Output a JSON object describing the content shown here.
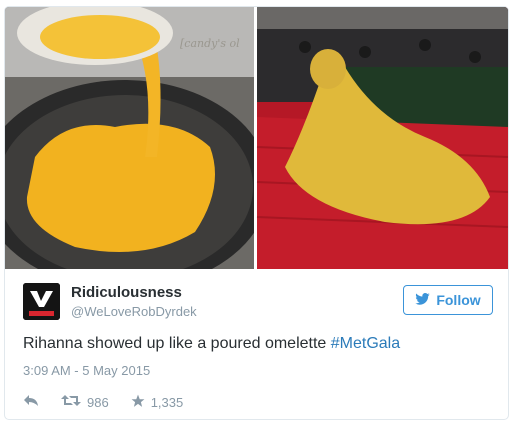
{
  "tweet": {
    "image_watermark": "[candy's ol",
    "author_name": "Ridiculousness",
    "author_handle": "@WeLoveRobDyrdek",
    "follow_label": "Follow",
    "text_before": "Rihanna showed up like a poured omelette ",
    "hashtag": "#MetGala",
    "timestamp": "3:09 AM - 5 May 2015",
    "retweets": "986",
    "favorites": "1,335"
  },
  "icons": {
    "reply": "reply-arrow-icon",
    "retweet": "retweet-icon",
    "favorite": "star-icon",
    "follow": "twitter-bird-icon"
  },
  "colors": {
    "accent": "#3b94d9",
    "hashtag": "#2b7bb9",
    "muted": "#8899a6",
    "text": "#292f33"
  }
}
